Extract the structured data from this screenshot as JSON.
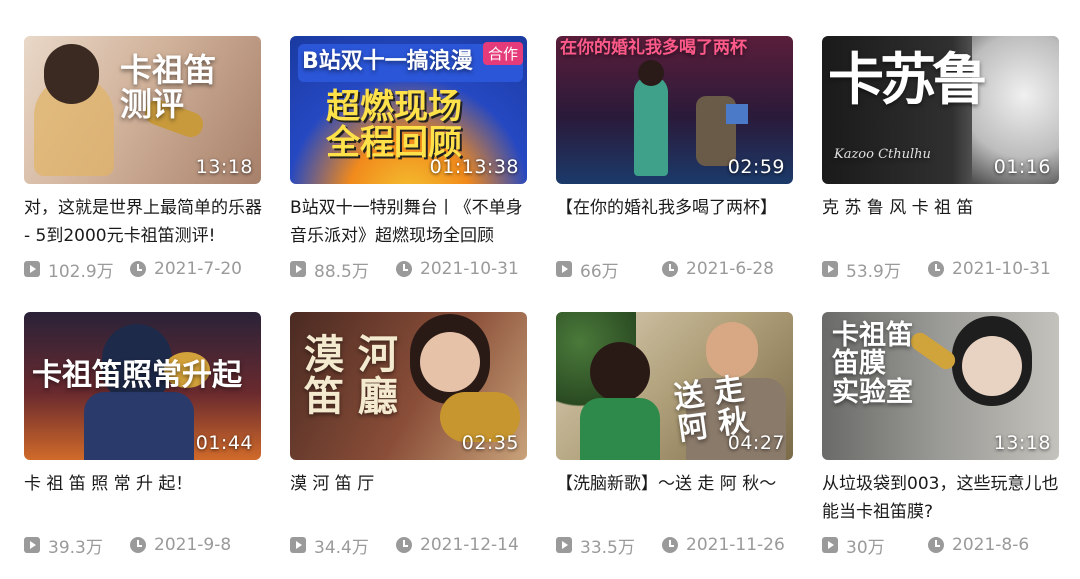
{
  "videos": [
    {
      "duration": "13:18",
      "thumb_text": "卡祖笛\n测评",
      "title": "对，这就是世界上最简单的乐器 - 5到2000元卡祖笛测评!",
      "views": "102.9万",
      "date": "2021-7-20",
      "bg": "#c9a995"
    },
    {
      "duration": "01:13:38",
      "thumb_text": "超燃现场\n全程回顾",
      "thumb_subtext": "B站双十一搞浪漫",
      "thumb_badge": "合作",
      "title": "B站双十一特别舞台丨《不单身音乐派对》超燃现场全回顾",
      "views": "88.5万",
      "date": "2021-10-31",
      "bg": "#1f4fb8"
    },
    {
      "duration": "02:59",
      "thumb_text": "在你的婚礼我多喝了两杯",
      "title": "【在你的婚礼我多喝了两杯】",
      "views": "66万",
      "date": "2021-6-28",
      "bg": "#3a1e3c"
    },
    {
      "duration": "01:16",
      "thumb_text": "卡苏鲁",
      "thumb_subtext": "Kazoo Cthulhu",
      "title": "克 苏 鲁 风 卡 祖 笛",
      "views": "53.9万",
      "date": "2021-10-31",
      "bg": "#2a2a2a"
    },
    {
      "duration": "01:44",
      "thumb_text": "卡祖笛照常升起",
      "title": "卡 祖 笛 照 常 升 起！",
      "views": "39.3万",
      "date": "2021-9-8",
      "bg": "#3a2a40"
    },
    {
      "duration": "02:35",
      "thumb_text": "漠 河\n笛 廳",
      "title": "漠 河 笛 厅",
      "views": "34.4万",
      "date": "2021-12-14",
      "bg": "#5a3a2e"
    },
    {
      "duration": "04:27",
      "thumb_text": "送 走\n阿 秋",
      "title": "【洗脑新歌】～送 走 阿 秋～",
      "views": "33.5万",
      "date": "2021-11-26",
      "bg": "#b89a6e"
    },
    {
      "duration": "13:18",
      "thumb_text": "卡祖笛\n笛膜\n实验室",
      "title": "从垃圾袋到003，这些玩意儿也能当卡祖笛膜?",
      "views": "30万",
      "date": "2021-8-6",
      "bg": "#8a8a88"
    }
  ]
}
